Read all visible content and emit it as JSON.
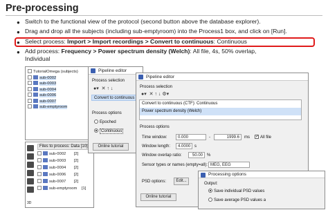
{
  "page": {
    "title": "Pre-processing",
    "bullets": [
      {
        "line1": "Switch to the functional view of the protocol (second button above the database explorer)."
      },
      {
        "line1": "Drag and drop all the subjects (including sub-emptyroom) into the Process1 box, and click on [Run]."
      },
      {
        "pre": "Select process: ",
        "bold": "Import > Import recordings > Convert to continuous",
        "post": ": Continuous"
      },
      {
        "pre": "Add process: ",
        "bold": "Frequency > Power spectrum density (Welch)",
        "post": ": All file, 4s, 50% overlap,",
        "line2": "Individual"
      }
    ]
  },
  "explorer": {
    "root": "TutorialOmega (subjects)",
    "subjects": [
      "sub-0002",
      "sub-0003",
      "sub-0004",
      "sub-0006",
      "sub-0007",
      "sub-emptyroom"
    ],
    "files_header": "Files to process: Data [10]",
    "files": [
      {
        "name": "sub-0002",
        "count": "[2]"
      },
      {
        "name": "sub-0003",
        "count": "[2]"
      },
      {
        "name": "sub-0004",
        "count": "[2]"
      },
      {
        "name": "sub-0006",
        "count": "[2]"
      },
      {
        "name": "sub-0007",
        "count": "[2]"
      },
      {
        "name": "sub-emptyroom",
        "count": "[1]"
      }
    ],
    "sidebar_label": "3D"
  },
  "editor1": {
    "title": "Pipeline editor",
    "process_selection": "Process selection",
    "item": "Convert to continuous (CTF): Co",
    "process_options": "Process options",
    "option_epoched": "Epoched",
    "option_continuous": "Continuous",
    "online_tutorial": "Online tutorial"
  },
  "editor2": {
    "title": "Pipeline editor",
    "process_selection": "Process selection",
    "items": [
      "Convert to continuous (CTF): Continuous",
      "Power spectrum density (Welch)"
    ],
    "process_options": "Process options",
    "time_window_label": "Time window:",
    "time_from": "0.000",
    "time_dash": "-",
    "time_to": "1999.6",
    "time_unit": "ms",
    "all_file": "All file",
    "window_length_label": "Window length:",
    "window_length": "4.0000",
    "window_length_unit": "s",
    "overlap_label": "Window overlap ratio:",
    "overlap": "50.00",
    "overlap_unit": "%",
    "sensor_label": "Sensor types or names (empty=all):",
    "sensor_value": "MEG, EEG",
    "psd_options_label": "PSD options:",
    "edit_button": "Edit...",
    "online_tutorial": "Online tutorial"
  },
  "processing_options": {
    "title": "Processing options",
    "output": "Output:",
    "opt1": "Save individual PSD values",
    "opt2": "Save average PSD values a"
  },
  "colors": {
    "highlight_border": "#e01a1a",
    "selection": "#cfe1f7"
  }
}
